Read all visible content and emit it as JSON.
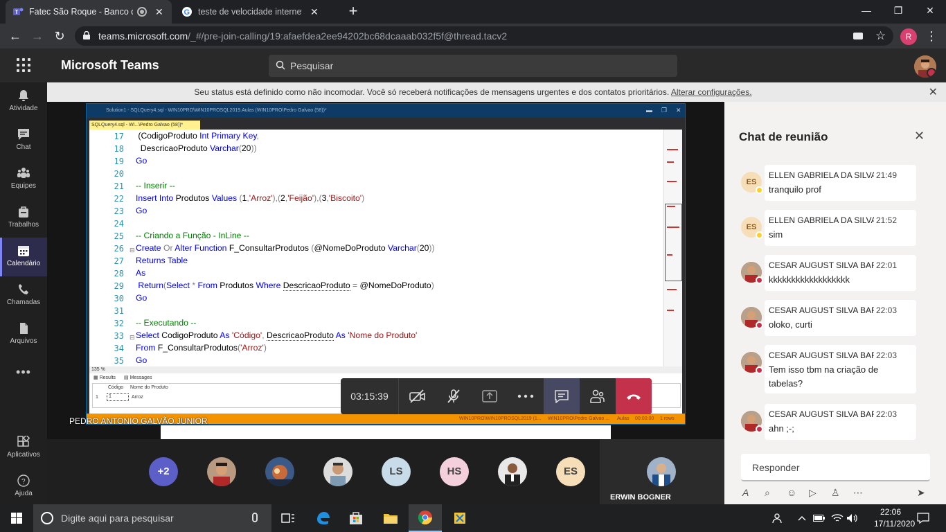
{
  "browser": {
    "tabs": [
      {
        "title": "Fatec São Roque - Banco de"
      },
      {
        "title": "teste de velocidade internet - Pe"
      }
    ],
    "url_host": "teams.microsoft.com",
    "url_path": "/_#/pre-join-calling/19:afaefdea2ee94202bc68dcaaab032f5f@thread.tacv2",
    "profile_initial": "R"
  },
  "teams": {
    "app_name": "Microsoft Teams",
    "search_placeholder": "Pesquisar",
    "rail": [
      {
        "label": "Atividade",
        "icon": "bell-icon"
      },
      {
        "label": "Chat",
        "icon": "chat-icon"
      },
      {
        "label": "Equipes",
        "icon": "teams-icon"
      },
      {
        "label": "Trabalhos",
        "icon": "assignments-icon"
      },
      {
        "label": "Calendário",
        "icon": "calendar-icon"
      },
      {
        "label": "Chamadas",
        "icon": "phone-icon"
      },
      {
        "label": "Arquivos",
        "icon": "files-icon"
      },
      {
        "label": "Aplicativos",
        "icon": "apps-icon"
      },
      {
        "label": "Ajuda",
        "icon": "help-icon"
      }
    ],
    "notice": {
      "text": "Seu status está definido como não incomodar. Você só receberá notificações de mensagens urgentes e dos contatos prioritários.",
      "link": "Alterar configurações."
    }
  },
  "ssms": {
    "title": "Solution1 - SQLQuery4.sql - WIN10PRO\\WIN10PROSQL2019.Aulas (WIN10PRO\\Pedro Galvao (58))*",
    "doc_tab": "SQLQuery4.sql - Wi...\\Pedro Galvao (58))*",
    "zoom": "135 %",
    "results_tab": "Results",
    "messages_tab": "Messages",
    "grid_header_1": "Código",
    "grid_header_2": "Nome do Produto",
    "grid_row_num": "1",
    "grid_cell_1": "1",
    "grid_cell_2": "Arroz",
    "status_server": "WIN10PRO\\WIN10PROSQL2019 (1...",
    "status_user": "WIN10PRO\\Pedro Galvao ...",
    "status_db": "Aulas",
    "status_time": "00:00:00",
    "status_rows": "1 rows",
    "line_numbers": [
      "17",
      "18",
      "19",
      "20",
      "21",
      "22",
      "23",
      "24",
      "25",
      "26",
      "27",
      "28",
      "29",
      "30",
      "31",
      "32",
      "33",
      "34",
      "35"
    ]
  },
  "presenter_name": "PEDRO ANTONIO GALVÃO JUNIOR",
  "call": {
    "timer": "03:15:39",
    "buttons": [
      "camera-off-icon",
      "mic-off-icon",
      "share-icon",
      "more-icon",
      "chat-icon",
      "participants-icon",
      "hangup-icon"
    ]
  },
  "participants": {
    "overflow": "+2",
    "initials": [
      "LS",
      "HS",
      "ES"
    ],
    "featured_name": "ERWIN BOGNER"
  },
  "chat": {
    "title": "Chat de reunião",
    "messages": [
      {
        "initials": "ES",
        "name": "ELLEN GABRIELA DA SILVA",
        "time": "21:49",
        "text": "tranquilo prof"
      },
      {
        "initials": "ES",
        "name": "ELLEN GABRIELA DA SILVA",
        "time": "21:52",
        "text": "sim"
      },
      {
        "initials": "",
        "name": "CESAR AUGUST SILVA BAR...",
        "time": "22:01",
        "text": "kkkkkkkkkkkkkkkkkk"
      },
      {
        "initials": "",
        "name": "CESAR AUGUST SILVA BAR...",
        "time": "22:03",
        "text": "oloko, curti"
      },
      {
        "initials": "",
        "name": "CESAR AUGUST SILVA BAR...",
        "time": "22:03",
        "text": "Tem isso tbm na criação de tabelas?"
      },
      {
        "initials": "",
        "name": "CESAR AUGUST SILVA BAR...",
        "time": "22:03",
        "text": "ahn ;-;"
      }
    ],
    "reply_placeholder": "Responder"
  },
  "taskbar": {
    "search_placeholder": "Digite aqui para pesquisar",
    "time": "22:06",
    "date": "17/11/2020"
  },
  "colors": {
    "teams_accent": "#7f85f5",
    "hangup": "#c4314b",
    "ssms_status": "#f49300"
  }
}
